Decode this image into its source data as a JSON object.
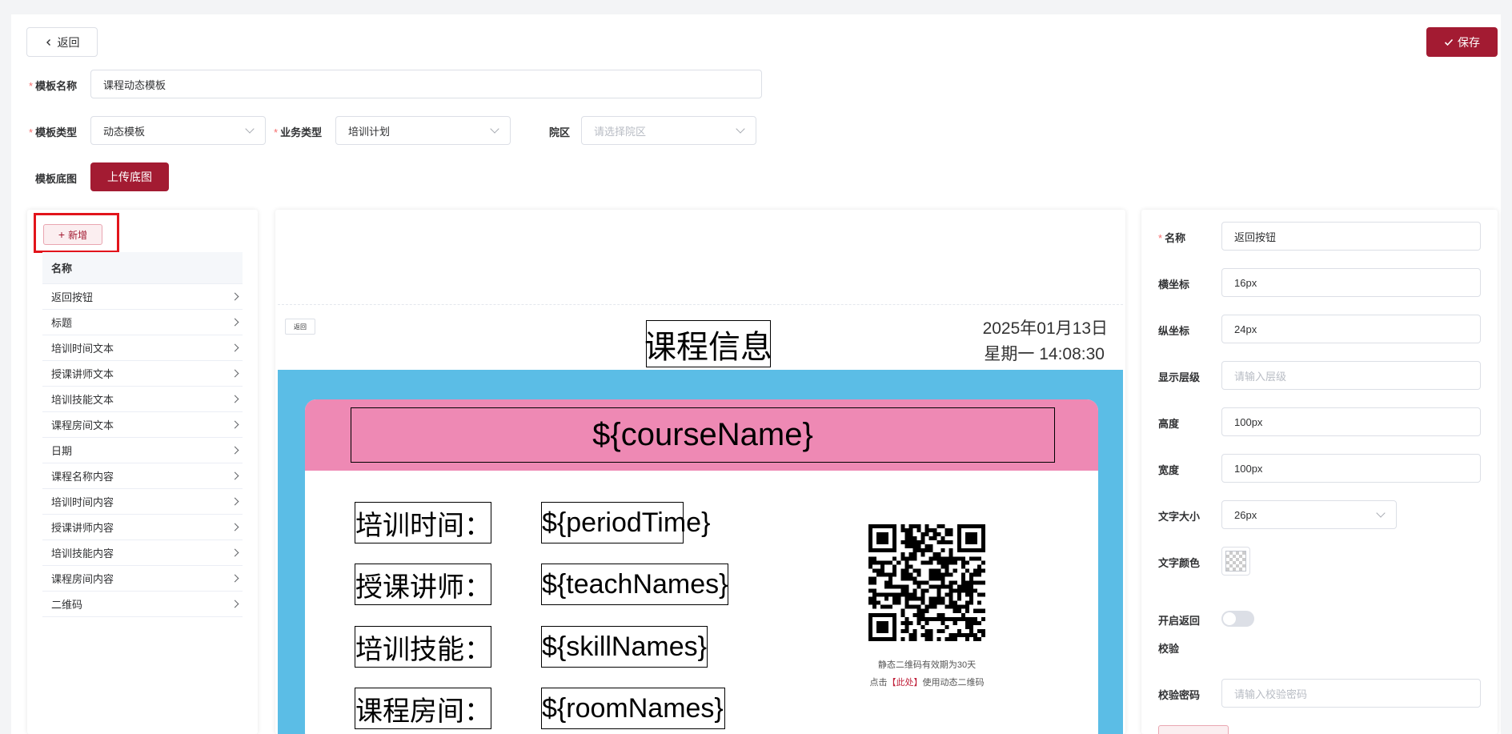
{
  "toolbar": {
    "back_label": "返回",
    "save_label": "保存"
  },
  "form": {
    "template_name_label": "模板名称",
    "template_name_value": "课程动态模板",
    "template_type_label": "模板类型",
    "template_type_value": "动态模板",
    "business_type_label": "业务类型",
    "business_type_value": "培训计划",
    "campus_label": "院区",
    "campus_placeholder": "请选择院区",
    "background_label": "模板底图",
    "upload_label": "上传底图"
  },
  "element_list": {
    "add_label": "新增",
    "header": "名称",
    "items": [
      "返回按钮",
      "标题",
      "培训时间文本",
      "授课讲师文本",
      "培训技能文本",
      "课程房间文本",
      "日期",
      "课程名称内容",
      "培训时间内容",
      "授课讲师内容",
      "培训技能内容",
      "课程房间内容",
      "二维码"
    ]
  },
  "preview": {
    "back_label": "返回",
    "title": "课程信息",
    "date": "2025年01月13日",
    "weekday_time": "星期一 14:08:30",
    "course_name": "${courseName}",
    "rows": [
      {
        "label": "培训时间：",
        "value": "${periodTime}"
      },
      {
        "label": "授课讲师：",
        "value": "${teachNames}"
      },
      {
        "label": "培训技能：",
        "value": "${skillNames}"
      },
      {
        "label": "课程房间：",
        "value": "${roomNames}"
      }
    ],
    "qr_note_1": "静态二维码有效期为30天",
    "qr_note_2_prefix": "点击",
    "qr_note_2_link": "【此处】",
    "qr_note_2_suffix": "使用动态二维码"
  },
  "properties": {
    "name_label": "名称",
    "name_value": "返回按钮",
    "x_label": "横坐标",
    "x_value": "16px",
    "y_label": "纵坐标",
    "y_value": "24px",
    "z_label": "显示层级",
    "z_placeholder": "请输入层级",
    "height_label": "高度",
    "height_value": "100px",
    "width_label": "宽度",
    "width_value": "100px",
    "font_size_label": "文字大小",
    "font_size_value": "26px",
    "font_color_label": "文字颜色",
    "return_check_label_1": "开启返回",
    "return_check_label_2": "校验",
    "check_password_label": "校验密码",
    "check_password_placeholder": "请输入校验密码"
  },
  "colors": {
    "brand": "#a31b32",
    "preview_bg": "#5bbde6",
    "card_header": "#ee89b4",
    "highlight_border": "#e2141b"
  }
}
